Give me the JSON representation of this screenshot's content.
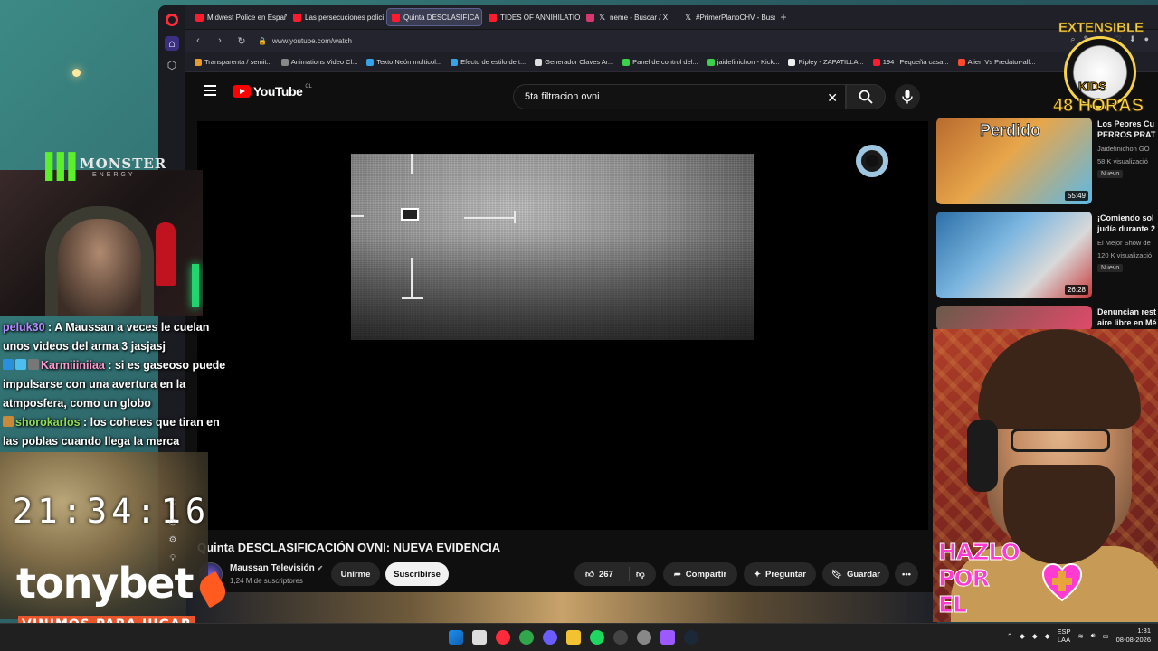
{
  "browser": {
    "tabs": [
      {
        "label": "Midwest Police en Españo",
        "icon": "youtube-icon",
        "active": false
      },
      {
        "label": "Las persecuciones policial",
        "icon": "youtube-icon",
        "active": false
      },
      {
        "label": "Quinta DESCLASIFICA",
        "icon": "youtube-icon",
        "active": true
      },
      {
        "label": "TIDES OF ANNIHILATION",
        "icon": "youtube-icon",
        "active": false
      },
      {
        "label": "neme - Buscar / X",
        "icon": "x-icon",
        "active": false
      },
      {
        "label": "#PrimerPlanoCHV - Busca",
        "icon": "x-icon",
        "active": false
      }
    ],
    "url": "www.youtube.com/watch",
    "bookmarks": [
      "Transparenta / semit...",
      "Animations Video Cl...",
      "Texto Neón multicol...",
      "Efecto de estilo de t...",
      "Generador Claves Ar...",
      "Panel de control del...",
      "jaidefinichon - Kick...",
      "Ripley - ZAPATILLA...",
      "194 | Pequeña casa...",
      "Alien Vs Predator-alf..."
    ]
  },
  "youtube": {
    "logo_text": "YouTube",
    "country": "CL",
    "search_value": "5ta filtracion ovni",
    "video_title": "Quinta DESCLASIFICACIÓN OVNI: NUEVA EVIDENCIA",
    "channel_name": "Maussan Televisión",
    "channel_subs": "1,24 M de suscriptores",
    "leave_label": "Unirme",
    "subscribe_label": "Suscribirse",
    "likes": "267",
    "share_label": "Compartir",
    "ask_label": "Preguntar",
    "save_label": "Guardar",
    "recommendations": [
      {
        "title1": "Los Peores Cu",
        "title2": "PERROS PRAT",
        "channel": "Jaidefinichon GO",
        "views": "58 K visualizació",
        "badge": "Nuevo",
        "duration": "55:49",
        "thumb_text": "Perdido"
      },
      {
        "title1": "¡Comiendo sol",
        "title2": "judía durante 2",
        "channel": "El Mejor Show de",
        "views": "120 K visualizació",
        "badge": "Nuevo",
        "duration": "26:28"
      },
      {
        "title1": "Denuncian rest",
        "title2": "aire libre en Mé"
      }
    ]
  },
  "overlay": {
    "monster_brand": "MONSTER",
    "monster_sub": "ENERGY",
    "chat": [
      {
        "user": "peluk30",
        "text": "A Maussan a veces le cuelan unos videos del arma 3 jasjasj"
      },
      {
        "user": "Karmiiiniiaa",
        "text": "si es gaseoso puede impulsarse con una avertura en la atmposfera, como un globo"
      },
      {
        "user": "shorokarlos",
        "text": "los cohetes que tiran en las poblas cuando llega la merca"
      }
    ],
    "clock": "21:34:16",
    "sponsor": "tonybet",
    "sponsor_tagline": "VINIMOS PARA JUGAR",
    "extensible_top": "EXTENSIBLE",
    "extensible_mid": "KIDS",
    "extensible_bottom": "48 HORAS",
    "hazlo_lines": [
      "HAZLO",
      "POR",
      "EL"
    ]
  },
  "taskbar": {
    "lang1": "ESP",
    "lang2": "LAA",
    "time": "1:31",
    "date": "08-08-2026"
  },
  "colors": {
    "youtube_red": "#ff0000",
    "opera_red": "#ff2b3a",
    "chat_user1": "#b38cff",
    "chat_user2": "#ff9ccf",
    "chat_user3": "#8fdc55",
    "tonybet_orange": "#e8552b",
    "hazlo_pink": "#ff3bd1"
  }
}
